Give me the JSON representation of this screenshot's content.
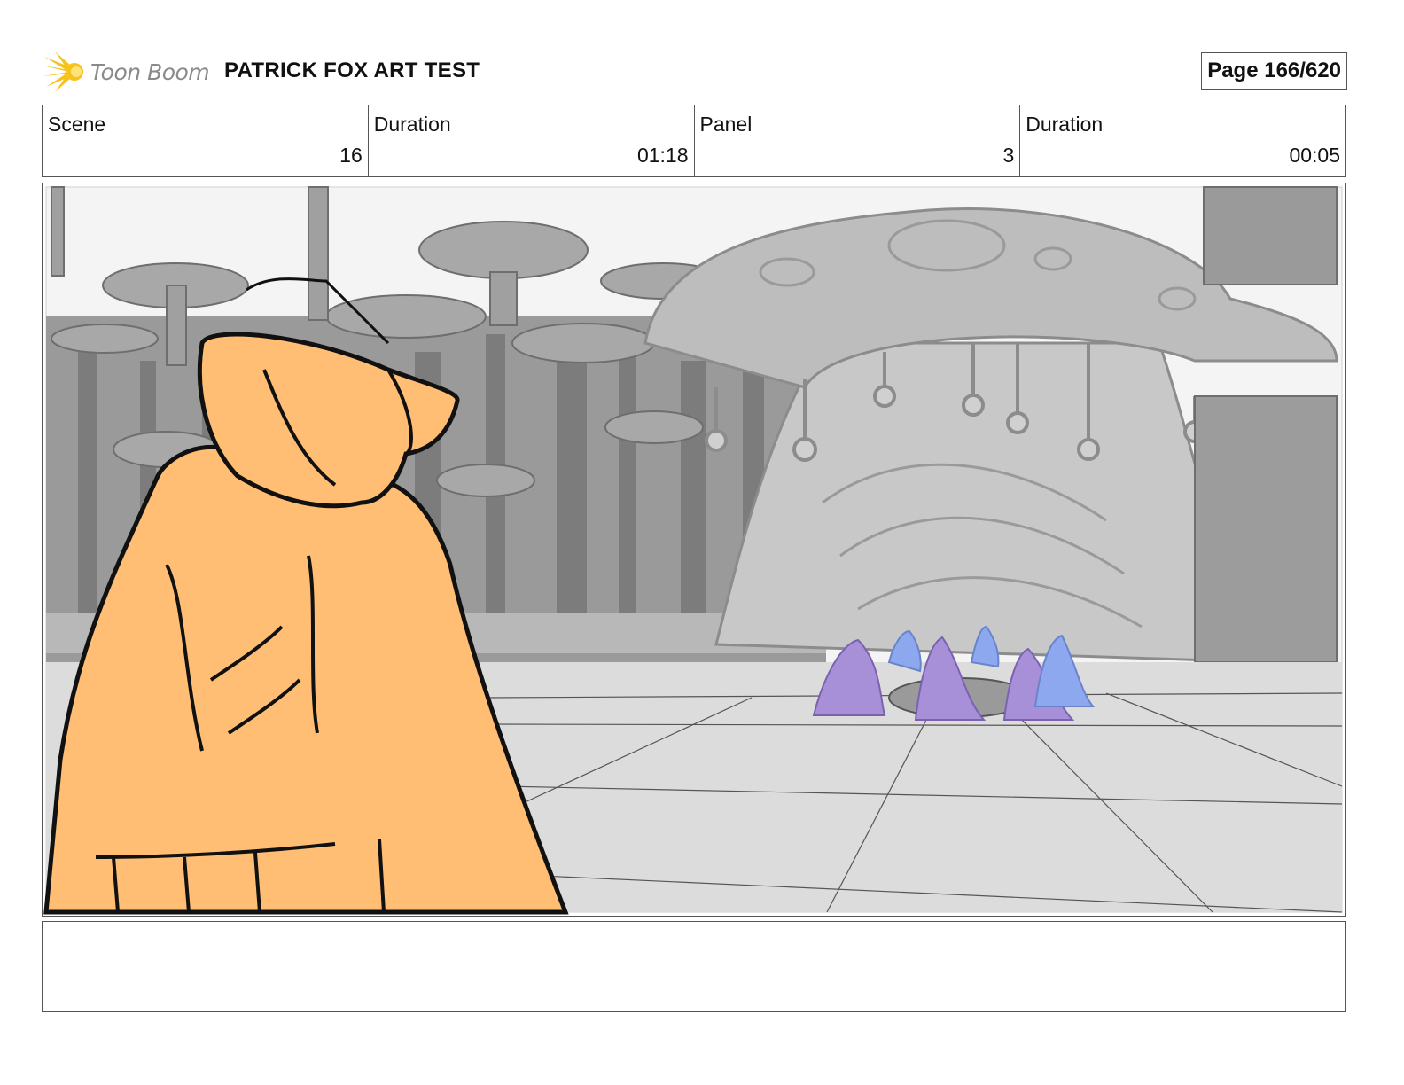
{
  "brand": {
    "logo_text": "Toon Boom",
    "logo_color": "#f7c21a"
  },
  "document": {
    "title": "PATRICK FOX ART TEST",
    "page": "Page 166/620"
  },
  "info": {
    "scene_label": "Scene",
    "scene_value": "16",
    "scene_duration_label": "Duration",
    "scene_duration_value": "01:18",
    "panel_label": "Panel",
    "panel_value": "3",
    "panel_duration_label": "Duration",
    "panel_duration_value": "00:05"
  },
  "notes": {
    "text": ""
  },
  "colors": {
    "hoodie": "#ffbe73",
    "creatures_purple": "#a890d8",
    "creatures_blue": "#8ea8f0",
    "stage": "#cfcfcf"
  }
}
